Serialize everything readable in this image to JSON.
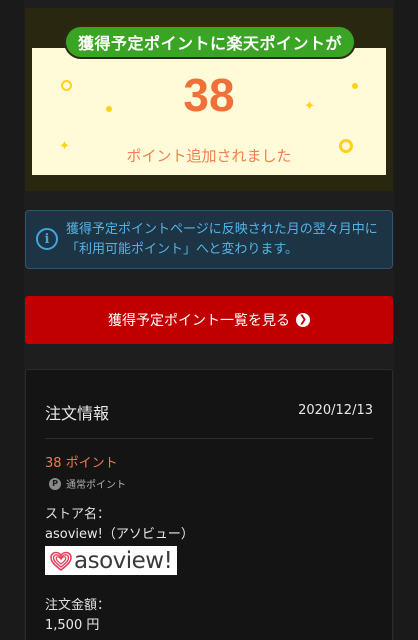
{
  "banner": {
    "headline": "獲得予定ポイントに楽天ポイントが",
    "points": "38",
    "caption": "ポイント追加されました"
  },
  "info": {
    "icon": "info-icon",
    "message": "獲得予定ポイントページに反映された月の翌々月中に「利用可能ポイント」へと変わります。"
  },
  "list_button": {
    "label": "獲得予定ポイント一覧を見る",
    "icon": "chevron-right-circle-icon"
  },
  "order": {
    "title": "注文情報",
    "date": "2020/12/13",
    "points_earned": "38 ポイント",
    "point_type": "通常ポイント",
    "point_badge": "P",
    "store_label": "ストア名：",
    "store_name": "asoview!（アソビュー）",
    "store_logo_text": "asoview!",
    "amount_label": "注文金額：",
    "amount_value": "1,500 円"
  },
  "colors": {
    "accent_orange": "#f0703a",
    "button_red": "#c00000",
    "pill_green": "#3aa424",
    "info_blue": "#56b3ea",
    "sparkle_yellow": "#ffd21a"
  }
}
